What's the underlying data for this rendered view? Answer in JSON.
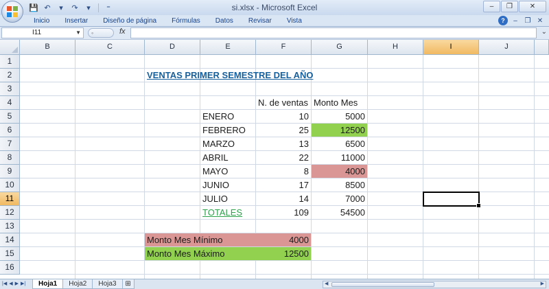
{
  "window": {
    "title": "si.xlsx - Microsoft Excel",
    "minimize": "–",
    "restore": "❐",
    "close": "✕"
  },
  "qat": {
    "save": "💾",
    "undo": "↶",
    "redo": "↷",
    "customize": "⁼"
  },
  "ribbon": {
    "tabs": [
      "Inicio",
      "Insertar",
      "Diseño de página",
      "Fórmulas",
      "Datos",
      "Revisar",
      "Vista"
    ],
    "help": "?",
    "min": "–",
    "restore": "❐",
    "close": "✕"
  },
  "formula_bar": {
    "name_box": "I11",
    "fx": "fx",
    "value": ""
  },
  "grid": {
    "columns": [
      "B",
      "C",
      "D",
      "E",
      "F",
      "G",
      "H",
      "I",
      "J"
    ],
    "active_column": "I",
    "rows": [
      "1",
      "2",
      "3",
      "4",
      "5",
      "6",
      "7",
      "8",
      "9",
      "10",
      "11",
      "12",
      "13",
      "14",
      "15",
      "16"
    ],
    "active_row": "11",
    "selected_cell": "I11"
  },
  "sheet": {
    "title": "VENTAS PRIMER SEMESTRE DEL AÑO",
    "header_sales": "N. de ventas",
    "header_amount": "Monto Mes",
    "months": [
      {
        "name": "ENERO",
        "sales": "10",
        "amount": "5000"
      },
      {
        "name": "FEBRERO",
        "sales": "25",
        "amount": "12500"
      },
      {
        "name": "MARZO",
        "sales": "13",
        "amount": "6500"
      },
      {
        "name": "ABRIL",
        "sales": "22",
        "amount": "11000"
      },
      {
        "name": "MAYO",
        "sales": "8",
        "amount": "4000"
      },
      {
        "name": "JUNIO",
        "sales": "17",
        "amount": "8500"
      },
      {
        "name": "JULIO",
        "sales": "14",
        "amount": "7000"
      }
    ],
    "totals_label": "TOTALES",
    "totals_sales": "109",
    "totals_amount": "54500",
    "min_label": "Monto Mes Mínimo",
    "min_value": "4000",
    "max_label": "Monto Mes Máximo",
    "max_value": "12500",
    "colors": {
      "max_fill": "#92d050",
      "min_fill": "#da9694",
      "title": "#17609e",
      "totals": "#2aa34a"
    }
  },
  "sheet_tabs": [
    "Hoja1",
    "Hoja2",
    "Hoja3"
  ],
  "active_sheet": "Hoja1"
}
